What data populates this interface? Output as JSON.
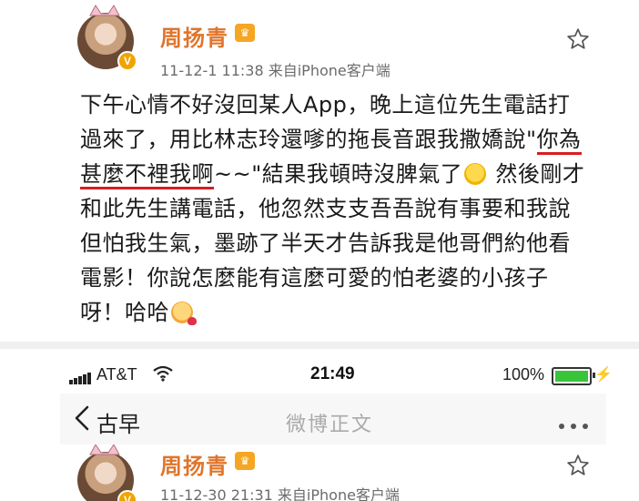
{
  "post": {
    "author": "周扬青",
    "verified_badge": "V",
    "vip_badge": "♛",
    "date": "11-12-1 11:38",
    "source": "来自iPhone客户端",
    "text_before": "下午心情不好沒回某人App，晚上這位先生電話打過來了，用比林志玲還嗲的拖長音跟我撒嬌說\"",
    "text_highlight": "你為甚麼不裡我啊",
    "text_after": "~~\"結果我頓時沒脾氣了",
    "text_rest": " 然後剛才和此先生講電話，他忽然支支吾吾說有事要和我說但怕我生氣，墨跡了半天才告訴我是他哥們約他看電影！你說怎麼能有這麼可愛的怕老婆的小孩子呀！哈哈",
    "emoji_1": "shrug-emoji",
    "emoji_2": "blush-heart-emoji",
    "star_icon": "star-outline-icon"
  },
  "status_bar": {
    "carrier": "AT&T",
    "time": "21:49",
    "battery": "100%",
    "battery_color": "#3ac43a"
  },
  "nav": {
    "back_label": "古早",
    "title": "微博正文",
    "more_icon": "more-dots-icon"
  },
  "post2": {
    "author": "周扬青",
    "verified_badge": "V",
    "vip_badge": "♛",
    "date": "11-12-30 21:31",
    "source": "来自iPhone客户端"
  },
  "colors": {
    "name": "#e0742a",
    "highlight_underline": "#d81e1e",
    "meta": "#6b6b6b"
  }
}
